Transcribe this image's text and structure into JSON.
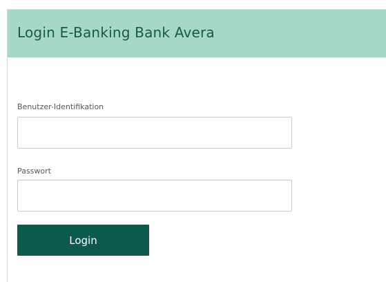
{
  "header": {
    "title": "Login E-Banking Bank Avera"
  },
  "form": {
    "user_label": "Benutzer-Identifikation",
    "user_value": "",
    "password_label": "Passwort",
    "password_value": "",
    "login_label": "Login"
  },
  "colors": {
    "header_background": "#a6d8c7",
    "header_text": "#145a4d",
    "button_background": "#0b5a4d",
    "button_text": "#ffffff"
  }
}
